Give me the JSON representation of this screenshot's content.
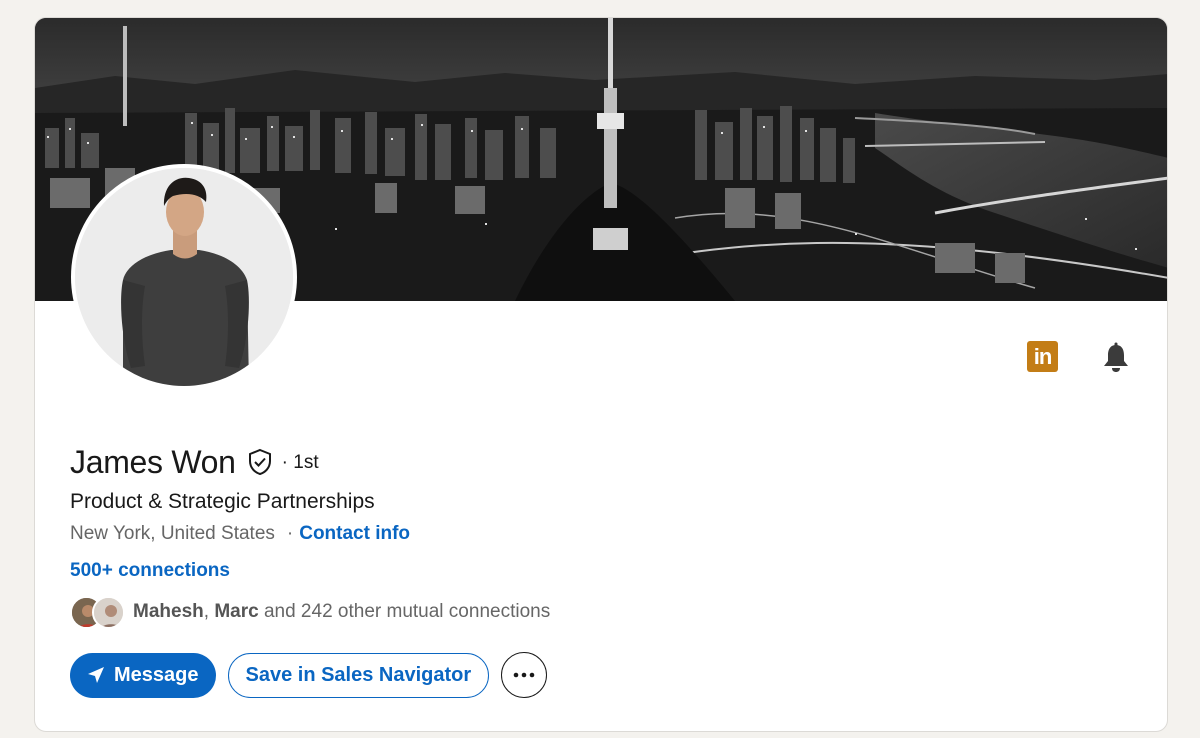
{
  "profile": {
    "name": "James Won",
    "degree": "· 1st",
    "headline": "Product & Strategic Partnerships",
    "location": "New York, United States",
    "location_separator": "·",
    "contact_info": "Contact info",
    "connections": "500+ connections",
    "mutual": {
      "first": "Mahesh",
      "separator": ",",
      "second": "Marc",
      "rest": "and 242 other mutual connections"
    }
  },
  "top_actions": {
    "linkedin_logo_text": "in",
    "linkedin_color": "#c37d16"
  },
  "actions": {
    "message_label": "Message",
    "save_label": "Save in Sales Navigator",
    "more_label": "···"
  },
  "colors": {
    "brand_blue": "#0a66c2",
    "page_bg": "#f4f2ee"
  },
  "icons": {
    "banner": "city-night-skyline-image",
    "avatar": "profile-photo",
    "verified": "shield-check-icon",
    "notify": "bell-icon",
    "message": "send-icon",
    "more": "ellipsis-icon"
  }
}
